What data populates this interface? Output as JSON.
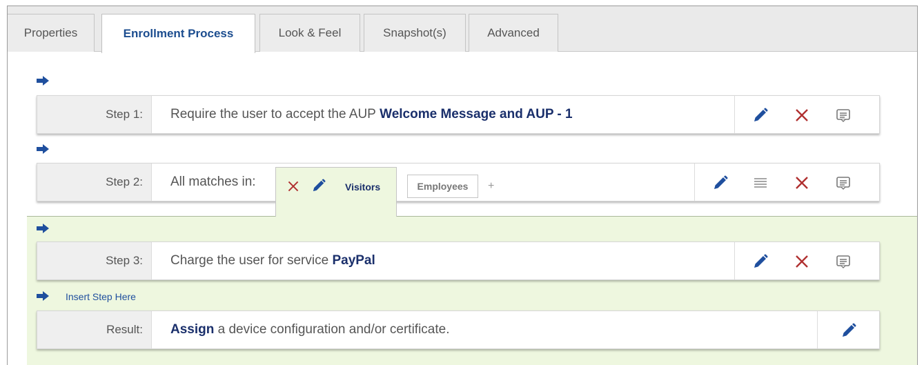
{
  "tabs": [
    {
      "label": "Properties"
    },
    {
      "label": "Enrollment Process",
      "active": true
    },
    {
      "label": "Look & Feel"
    },
    {
      "label": "Snapshot(s)"
    },
    {
      "label": "Advanced"
    }
  ],
  "steps": [
    {
      "label": "Step 1:",
      "text": "Require the user to accept the AUP ",
      "bold": "Welcome Message and AUP - 1"
    },
    {
      "label": "Step 2:",
      "text": "All matches in:"
    },
    {
      "label": "Step 3:",
      "text": "Charge the user for service ",
      "bold": "PayPal"
    }
  ],
  "step2_tabs": {
    "active": "Visitors",
    "other": "Employees",
    "add": "+"
  },
  "insert_link": "Insert Step Here",
  "result": {
    "label": "Result:",
    "bold": "Assign",
    "text": " a device configuration and/or certificate."
  },
  "colors": {
    "accent": "#1c4d8f",
    "delete": "#b03030",
    "highlight_bg": "#eef7df"
  },
  "icons": [
    "arrow-right-icon",
    "edit-pencil-icon",
    "delete-x-icon",
    "comment-icon",
    "list-icon"
  ]
}
